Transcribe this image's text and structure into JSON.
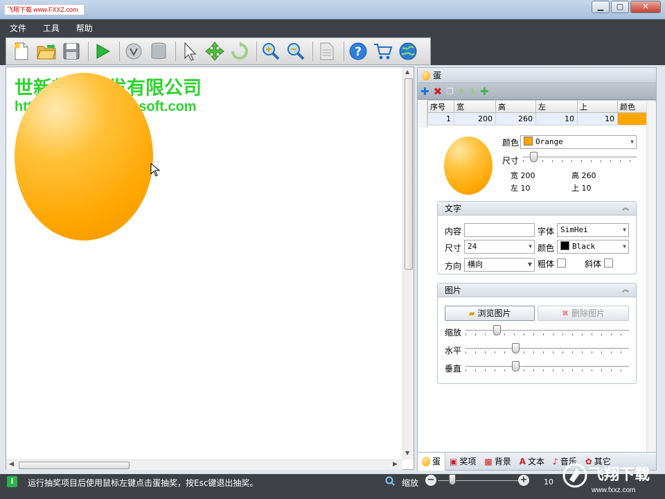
{
  "titlebar": {
    "logo_text": "飞翔下载 www.FXXZ.com",
    "app_title": ""
  },
  "window_buttons": {
    "minimize": "▁",
    "maximize": "▢",
    "close": "✕"
  },
  "menu": {
    "file": "文件",
    "tools": "工具",
    "help": "帮助"
  },
  "toolbar": {
    "icons": [
      "new-icon",
      "open-icon",
      "save-icon",
      "play-icon",
      "statistics-icon",
      "database-icon",
      "pointer-icon",
      "move-icon",
      "rotate-icon",
      "zoom-in-icon",
      "zoom-out-icon",
      "document-icon",
      "help-icon",
      "shop-cart-icon",
      "globe-icon"
    ]
  },
  "canvas": {
    "title": "世新软件开发有限公司",
    "url": "http://www.sxruninsoft.com",
    "egg_color": "#FFA500"
  },
  "panel": {
    "header_label": "蛋",
    "tools": [
      "+",
      "✕",
      "⧉",
      "⌂",
      "⌂",
      "✚"
    ],
    "grid": {
      "headers": [
        "序号",
        "宽",
        "高",
        "左",
        "上",
        "颜色"
      ],
      "rows": [
        {
          "index": "1",
          "width": "200",
          "height": "260",
          "left": "10",
          "top": "10",
          "color": "#FFA500"
        }
      ]
    },
    "props": {
      "color_label": "颜色",
      "color_value": "Orange",
      "size_label": "尺寸",
      "width_label": "宽",
      "width_value": "200",
      "height_label": "高",
      "height_value": "260",
      "left_label": "左",
      "left_value": "10",
      "top_label": "上",
      "top_value": "10"
    },
    "text_section": {
      "title": "文字",
      "content_label": "内容",
      "content_value": "",
      "font_label": "字体",
      "font_value": "SimHei",
      "size_label": "尺寸",
      "size_value": "24",
      "color_label": "颜色",
      "color_value": "Black",
      "direction_label": "方向",
      "direction_value": "横向",
      "bold_label": "粗体",
      "italic_label": "斜体"
    },
    "image_section": {
      "title": "图片",
      "browse_button": "浏览图片",
      "delete_button": "删除图片",
      "scale_label": "缩放",
      "horizontal_label": "水平",
      "vertical_label": "垂直"
    },
    "tabs": [
      "蛋",
      "奖项",
      "背景",
      "文本",
      "音乐",
      "其它"
    ]
  },
  "status": {
    "message": "运行抽奖项目后使用鼠标左键点击蛋抽奖，按Esc键退出抽奖。",
    "zoom_label": "缩放",
    "zoom_value": "10"
  },
  "watermark": {
    "text": "飞翔下载",
    "url": "www.fxxz.com"
  }
}
